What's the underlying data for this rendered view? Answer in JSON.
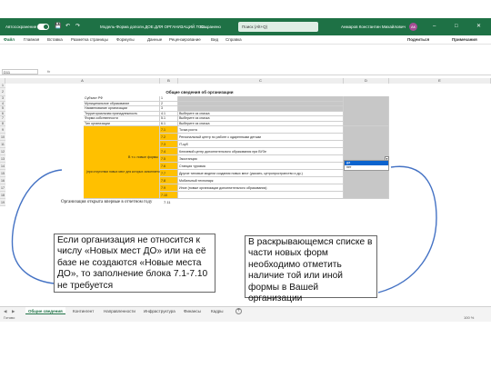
{
  "title_bar": {
    "autosave": "Автосохранение",
    "filename": "Модель-Форма дополн.ДОЕ.ДЛЯ ОРГАНИЗАЦИЙ.ТОО...",
    "saved_status": "Сохранено",
    "search_placeholder": "Поиск (Alt+Q)",
    "user": "Анмаров Константин Михайлович",
    "avatar_initials": "АК"
  },
  "ribbon": {
    "tabs": [
      "Файл",
      "Главная",
      "Вставка",
      "Разметка страницы",
      "Формулы",
      "Данные",
      "Рецензирование",
      "Вид",
      "Справка"
    ],
    "share": "Подеиться",
    "notes": "Примечания"
  },
  "formula_bar": {
    "name_box": "D11",
    "fx": "fx"
  },
  "columns": [
    "A",
    "B",
    "C",
    "D",
    "E"
  ],
  "sheet": {
    "header": "Общие сведения об организации",
    "rows": [
      {
        "num": "1",
        "a": "",
        "b": "",
        "c": ""
      },
      {
        "num": "2",
        "a": "",
        "b": "",
        "c": ""
      },
      {
        "num": "3",
        "a": "Субъект РФ",
        "b": "1",
        "c": ""
      },
      {
        "num": "4",
        "a": "Муниципальное образование",
        "b": "2",
        "c": ""
      },
      {
        "num": "5",
        "a": "Наименование организации",
        "b": "3",
        "c": ""
      },
      {
        "num": "6",
        "a": "Территориальная принадлежность",
        "b": "4.1",
        "c": "Выберите из списка"
      },
      {
        "num": "7",
        "a": "Форма собственности",
        "b": "5.1",
        "c": "Выберите из списка"
      },
      {
        "num": "8",
        "a": "Тип организации",
        "b": "6.1",
        "c": "Выберите из списка"
      },
      {
        "num": "9",
        "a": "",
        "b": "7.1",
        "c": "Точка роста"
      },
      {
        "num": "10",
        "a": "",
        "b": "7.2",
        "c": "Региональный центр по работе с одаренными детьми"
      },
      {
        "num": "11",
        "a": "",
        "b": "7.3",
        "c": "IT-куб"
      },
      {
        "num": "12",
        "a": "",
        "b": "7.4",
        "c": "Ключевой центр дополнительного образования при ВУЗе"
      },
      {
        "num": "13",
        "a": "",
        "b": "7.5",
        "c": "Экостанция"
      },
      {
        "num": "14",
        "a": "",
        "b": "7.6",
        "c": "Станция туризма"
      },
      {
        "num": "15",
        "a": "",
        "b": "7.7",
        "c": "Другие типовые модели создания новых мест (указать, цетропространство и др.)"
      },
      {
        "num": "16",
        "a": "",
        "b": "7.8",
        "c": "Мобильный технопарк"
      },
      {
        "num": "17",
        "a": "",
        "b": "7.9",
        "c": "Иное (новые организации дополнительного образования)"
      },
      {
        "num": "18",
        "a": "",
        "b": "7.10",
        "c": ""
      },
      {
        "num": "19",
        "a": "Организация открыта впервые в отчетном году",
        "b": "7.11",
        "c": ""
      }
    ],
    "orange_block_line1": "В т.ч. новые формы",
    "orange_block_line2": "(при отсутствии новых мест для которых заполняется по требуете)",
    "dropdown_options": [
      "да",
      "нет"
    ]
  },
  "sheet_tabs": [
    "Общие сведения",
    "Контингент",
    "Направленности",
    "Инфраструктура",
    "Финансы",
    "Кадры"
  ],
  "status_bar": {
    "left": "Готово",
    "zoom": "100 %"
  },
  "callouts": {
    "left": "Если организация не относится к числу «Новых мест ДО» или на её базе не создаются «Новые места ДО», то заполнение блока 7.1-7.10 не требуется",
    "right": "В раскрывающемся списке в части новых форм необходимо отметить наличие той или иной формы в Вашей организации"
  },
  "colors": {
    "excel_green": "#1e7145",
    "highlight_orange": "#ffc000",
    "curve_blue": "#4472c4"
  }
}
